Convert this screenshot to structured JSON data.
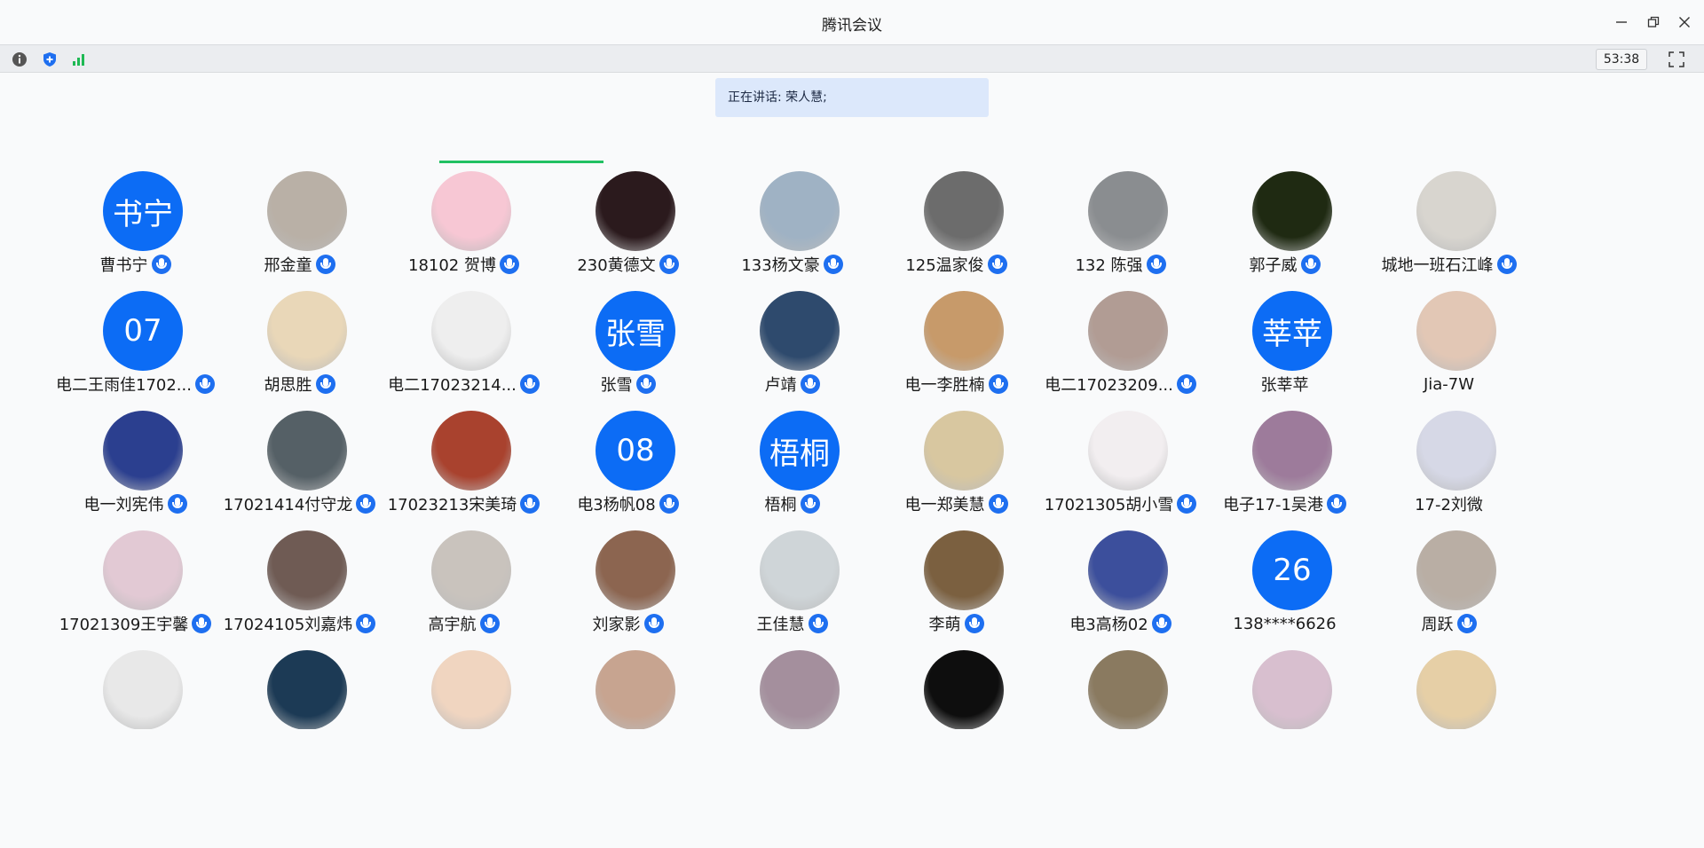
{
  "window": {
    "title": "腾讯会议"
  },
  "toolbar": {
    "info_icon": "info-icon",
    "shield_icon": "shield-icon",
    "signal_icon": "signal-icon",
    "timer": "53:38",
    "fullscreen_icon": "fullscreen-icon"
  },
  "speaking": {
    "text": "正在讲话: 荣人慧;"
  },
  "colors": {
    "accent": "#0c6cf5",
    "mic": "#1e6ff0",
    "speaking_indicator": "#22c163",
    "banner": "#dce8fb"
  },
  "participants": [
    {
      "name": "曹书宁",
      "avatar_text": "书宁",
      "mic": true
    },
    {
      "name": "邢金童",
      "avatar_color": "#b9b0a6",
      "mic": true
    },
    {
      "name": "18102 贺博",
      "avatar_color": "#f7c7d4",
      "mic": true
    },
    {
      "name": "230黄德文",
      "avatar_color": "#2b1a1d",
      "mic": true
    },
    {
      "name": "133杨文豪",
      "avatar_color": "#9fb2c4",
      "mic": true
    },
    {
      "name": "125温家俊",
      "avatar_color": "#6c6c6c",
      "mic": true
    },
    {
      "name": "132 陈强",
      "avatar_color": "#8a8d90",
      "mic": true
    },
    {
      "name": "郭子威",
      "avatar_color": "#1f2a12",
      "mic": true
    },
    {
      "name": "城地一班石江峰",
      "avatar_color": "#d8d5cf",
      "mic": true
    },
    {
      "name": "电二王雨佳1702...",
      "avatar_text": "07",
      "mic": true
    },
    {
      "name": "胡思胜",
      "avatar_color": "#e9d7b8",
      "mic": true
    },
    {
      "name": "电二17023214...",
      "avatar_color": "#eeeeee",
      "mic": true
    },
    {
      "name": "张雪",
      "avatar_text": "张雪",
      "mic": true
    },
    {
      "name": "卢靖",
      "avatar_color": "#2e4a6d",
      "mic": true
    },
    {
      "name": "电一李胜楠",
      "avatar_color": "#c79a6a",
      "mic": true
    },
    {
      "name": "电二17023209...",
      "avatar_color": "#b19c94",
      "mic": true
    },
    {
      "name": "张莘苹",
      "avatar_text": "莘苹",
      "mic": false
    },
    {
      "name": "Jia-7W",
      "avatar_color": "#e2c7b5",
      "mic": false
    },
    {
      "name": "电一刘宪伟",
      "avatar_color": "#2b3f8f",
      "mic": true
    },
    {
      "name": "17021414付守龙",
      "avatar_color": "#556066",
      "mic": true
    },
    {
      "name": "17023213宋美琦",
      "avatar_color": "#a9422e",
      "mic": true
    },
    {
      "name": "电3杨帆08",
      "avatar_text": "08",
      "mic": true
    },
    {
      "name": "梧桐",
      "avatar_text": "梧桐",
      "mic": true
    },
    {
      "name": "电一郑美慧",
      "avatar_color": "#d8c7a0",
      "mic": true
    },
    {
      "name": "17021305胡小雪",
      "avatar_color": "#f2eef0",
      "mic": true
    },
    {
      "name": "电子17-1吴港",
      "avatar_color": "#9d7b9b",
      "mic": true
    },
    {
      "name": "17-2刘微",
      "avatar_color": "#d6d8e6",
      "mic": false
    },
    {
      "name": "17021309王宇馨",
      "avatar_color": "#e2c9d4",
      "mic": true
    },
    {
      "name": "17024105刘嘉炜",
      "avatar_color": "#6f5b54",
      "mic": true
    },
    {
      "name": "高宇航",
      "avatar_color": "#c9c3bd",
      "mic": true
    },
    {
      "name": "刘家影",
      "avatar_color": "#8c6550",
      "mic": true
    },
    {
      "name": "王佳慧",
      "avatar_color": "#cfd5d8",
      "mic": true
    },
    {
      "name": "李萌",
      "avatar_color": "#7b6040",
      "mic": true
    },
    {
      "name": "电3高杨02",
      "avatar_color": "#3c4f9c",
      "mic": true
    },
    {
      "name": "138****6626",
      "avatar_text": "26",
      "mic": false
    },
    {
      "name": "周跃",
      "avatar_color": "#b9aea4",
      "mic": true
    },
    {
      "name": "",
      "avatar_color": "#e8e8e8",
      "mic": false
    },
    {
      "name": "",
      "avatar_color": "#1c3a55",
      "mic": false
    },
    {
      "name": "",
      "avatar_color": "#f0d5c0",
      "mic": false
    },
    {
      "name": "",
      "avatar_color": "#c7a490",
      "mic": false
    },
    {
      "name": "",
      "avatar_color": "#a48f9d",
      "mic": false
    },
    {
      "name": "",
      "avatar_color": "#0e0e0e",
      "mic": false
    },
    {
      "name": "",
      "avatar_color": "#8a7a60",
      "mic": false
    },
    {
      "name": "",
      "avatar_color": "#d8bfcf",
      "mic": false
    },
    {
      "name": "",
      "avatar_color": "#e6cfa6",
      "mic": false
    }
  ]
}
